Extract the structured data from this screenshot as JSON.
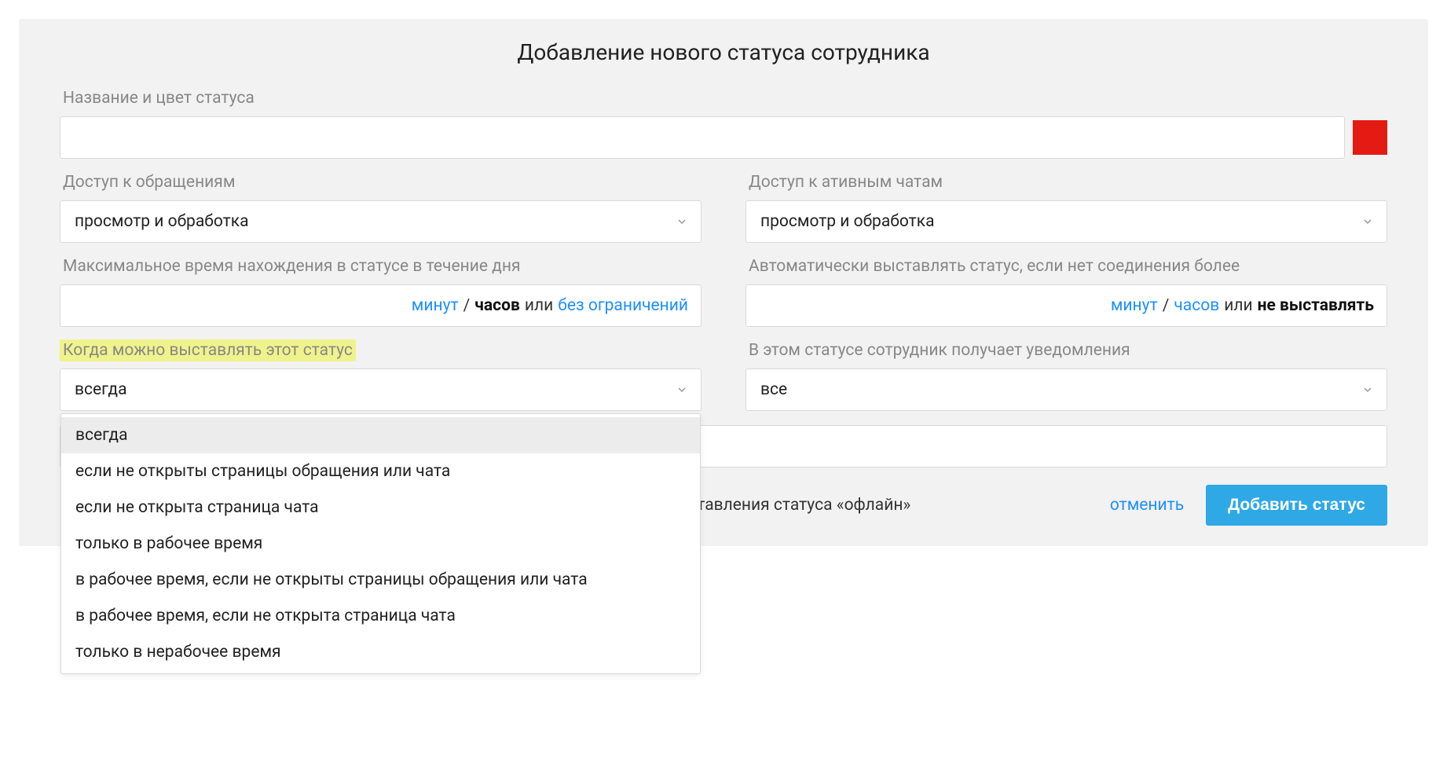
{
  "title": "Добавление нового статуса сотрудника",
  "name_color": {
    "label": "Название и цвет статуса",
    "value": "",
    "color": "#e31b13"
  },
  "access_requests": {
    "label": "Доступ к обращениям",
    "value": "просмотр и обработка"
  },
  "access_chats": {
    "label": "Доступ к ативным чатам",
    "value": "просмотр и обработка"
  },
  "max_time": {
    "label": "Максимальное время нахождения в статусе в течение дня",
    "minutes": "минут",
    "slash": "/",
    "hours": "часов",
    "or": "или",
    "unlimited": "без ограничений"
  },
  "auto_status": {
    "label": "Автоматически выставлять статус, если нет соединения более",
    "minutes": "минут",
    "slash": "/",
    "hours": "часов",
    "or": "или",
    "no_set": "не выставлять"
  },
  "when_allow": {
    "label": "Когда можно выставлять этот статус",
    "value": "всегда",
    "options": [
      "всегда",
      "если не открыты страницы обращения или чата",
      "если не открыта страница чата",
      "только в рабочее время",
      "в рабочее время, если не открыты страницы обращения или чата",
      "в рабочее время, если не открыта страница чата",
      "только в нерабочее время"
    ]
  },
  "notifications": {
    "label": "В этом статусе сотрудник получает уведомления",
    "value": "все"
  },
  "footer": {
    "offline_caption": "овыставления статуса «офлайн»",
    "cancel": "отменить",
    "submit": "Добавить статус"
  }
}
